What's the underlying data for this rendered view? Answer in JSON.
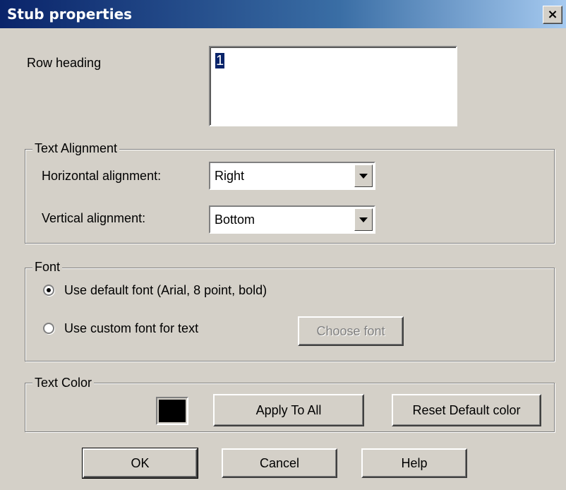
{
  "window": {
    "title": "Stub properties",
    "close_glyph": "×"
  },
  "row_heading": {
    "label": "Row heading",
    "value": "1"
  },
  "text_alignment": {
    "legend": "Text Alignment",
    "horizontal_label": "Horizontal alignment:",
    "horizontal_value": "Right",
    "vertical_label": "Vertical alignment:",
    "vertical_value": "Bottom"
  },
  "font": {
    "legend": "Font",
    "default_option": "Use default font (Arial, 8 point, bold)",
    "custom_option": "Use custom font for text",
    "selected": "default",
    "choose_font_button": "Choose font"
  },
  "text_color": {
    "legend": "Text Color",
    "color": "#000000",
    "apply_to_all_button": "Apply To All",
    "reset_button": "Reset Default color"
  },
  "footer": {
    "ok": "OK",
    "cancel": "Cancel",
    "help": "Help"
  },
  "colors": {
    "titlebar_start": "#0a246a",
    "face": "#d4d0c8"
  }
}
